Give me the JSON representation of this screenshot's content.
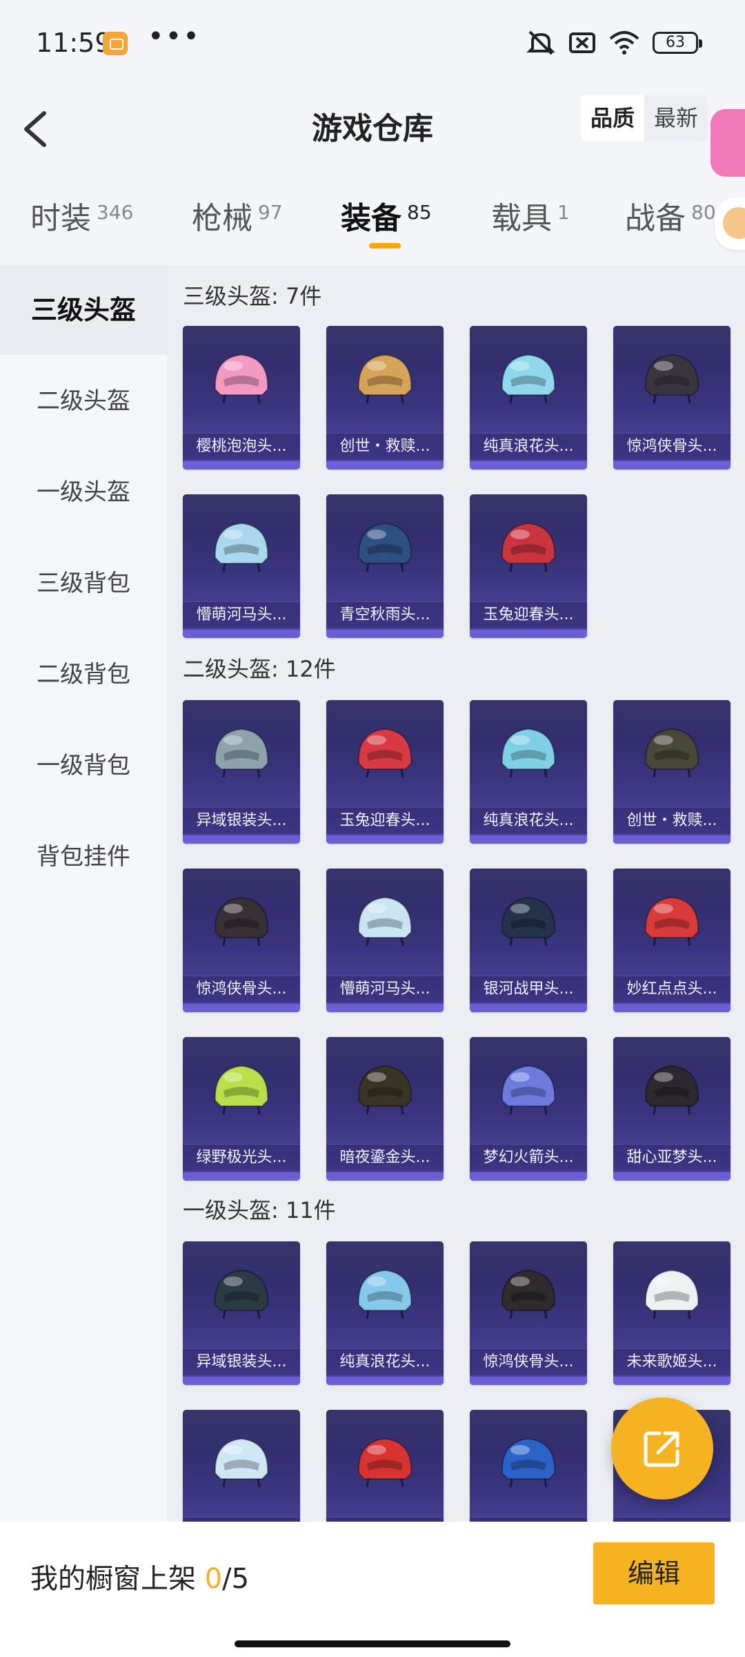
{
  "status_bar": {
    "time": "11:59",
    "dots": "•••",
    "battery": "63"
  },
  "header": {
    "title": "游戏仓库",
    "sort_options": [
      {
        "label": "品质",
        "active": true
      },
      {
        "label": "最新",
        "active": false
      }
    ]
  },
  "tabs": [
    {
      "label": "时装",
      "count": "346"
    },
    {
      "label": "枪械",
      "count": "97"
    },
    {
      "label": "装备",
      "count": "85",
      "active": true
    },
    {
      "label": "载具",
      "count": "1"
    },
    {
      "label": "战备",
      "count": "80"
    }
  ],
  "sidebar": {
    "items": [
      {
        "label": "三级头盔",
        "active": true
      },
      {
        "label": "二级头盔"
      },
      {
        "label": "一级头盔"
      },
      {
        "label": "三级背包"
      },
      {
        "label": "二级背包"
      },
      {
        "label": "一级背包"
      },
      {
        "label": "背包挂件"
      }
    ]
  },
  "sections": [
    {
      "title": "三级头盔: 7件",
      "items": [
        {
          "name": "樱桃泡泡头...",
          "color": "#f39ac4"
        },
        {
          "name": "创世・救赎...",
          "color": "#d6a35a"
        },
        {
          "name": "纯真浪花头...",
          "color": "#8fd7ec"
        },
        {
          "name": "惊鸿侠骨头...",
          "color": "#3b3540"
        },
        {
          "name": "懵萌河马头...",
          "color": "#a9d7ee"
        },
        {
          "name": "青空秋雨头...",
          "color": "#2f4e82"
        },
        {
          "name": "玉兔迎春头...",
          "color": "#c9343f"
        }
      ]
    },
    {
      "title": "二级头盔: 12件",
      "items": [
        {
          "name": "异域银装头...",
          "color": "#8da2ad"
        },
        {
          "name": "玉兔迎春头...",
          "color": "#d83a44"
        },
        {
          "name": "纯真浪花头...",
          "color": "#7fd0e6"
        },
        {
          "name": "创世・救赎...",
          "color": "#4a4638"
        },
        {
          "name": "惊鸿侠骨头...",
          "color": "#3a2f35"
        },
        {
          "name": "懵萌河马头...",
          "color": "#c9e4f3"
        },
        {
          "name": "银河战甲头...",
          "color": "#25324c"
        },
        {
          "name": "妙红点点头...",
          "color": "#d93a3a"
        },
        {
          "name": "绿野极光头...",
          "color": "#b9e04a"
        },
        {
          "name": "暗夜鎏金头...",
          "color": "#3a3426"
        },
        {
          "name": "梦幻火箭头...",
          "color": "#6d7be0"
        },
        {
          "name": "甜心亚梦头...",
          "color": "#2c2830"
        }
      ]
    },
    {
      "title": "一级头盔: 11件",
      "items": [
        {
          "name": "异域银装头...",
          "color": "#2b3a45"
        },
        {
          "name": "纯真浪花头...",
          "color": "#84c8ea"
        },
        {
          "name": "惊鸿侠骨头...",
          "color": "#302a2c"
        },
        {
          "name": "未来歌姬头...",
          "color": "#eef0f2"
        },
        {
          "name": "",
          "color": "#cfe6f4"
        },
        {
          "name": "",
          "color": "#d83333"
        },
        {
          "name": "",
          "color": "#2c63c8"
        },
        {
          "name": "",
          "color": "#f2e36a"
        }
      ]
    }
  ],
  "bottom_bar": {
    "label": "我的橱窗上架 ",
    "count_current": "0",
    "count_total": "/5",
    "edit_label": "编辑"
  }
}
